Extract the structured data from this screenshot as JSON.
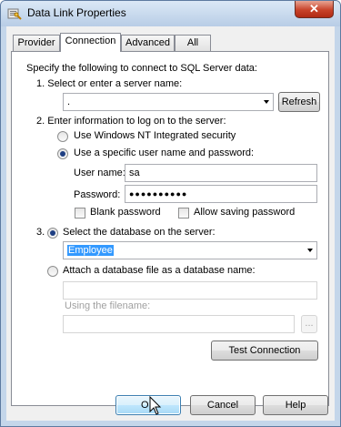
{
  "window": {
    "title": "Data Link Properties",
    "close_label": "✕"
  },
  "tabs": [
    {
      "label": "Provider"
    },
    {
      "label": "Connection"
    },
    {
      "label": "Advanced"
    },
    {
      "label": "All"
    }
  ],
  "connection": {
    "intro": "Specify the following to connect to SQL Server data:",
    "step1": "1. Select or enter a server name:",
    "server_value": ".",
    "refresh_label": "Refresh",
    "step2": "2. Enter information to log on to the server:",
    "nt_security_label": "Use Windows NT Integrated security",
    "specific_user_label": "Use a specific user name and password:",
    "username_label": "User name:",
    "username_value": "sa",
    "password_label": "Password:",
    "password_value": "●●●●●●●●●●",
    "blank_password_label": "Blank password",
    "allow_saving_label": "Allow saving password",
    "step3_prefix": "3.",
    "select_db_label": "Select the database on the server:",
    "database_value": "Employee",
    "attach_label": "Attach a database file as a database name:",
    "attach_value": "",
    "filename_label": "Using the filename:",
    "filename_value": "",
    "browse_label": "...",
    "test_label": "Test Connection"
  },
  "footer": {
    "ok_label": "OK",
    "cancel_label": "Cancel",
    "help_label": "Help"
  },
  "state": {
    "active_tab": "Connection",
    "logon_mode": "specific_user",
    "database_mode": "select",
    "blank_password": false,
    "allow_saving_password": false
  },
  "colors": {
    "selection": "#3399ff",
    "close": "#c8432a",
    "title_bg": "#c4d6ea"
  }
}
